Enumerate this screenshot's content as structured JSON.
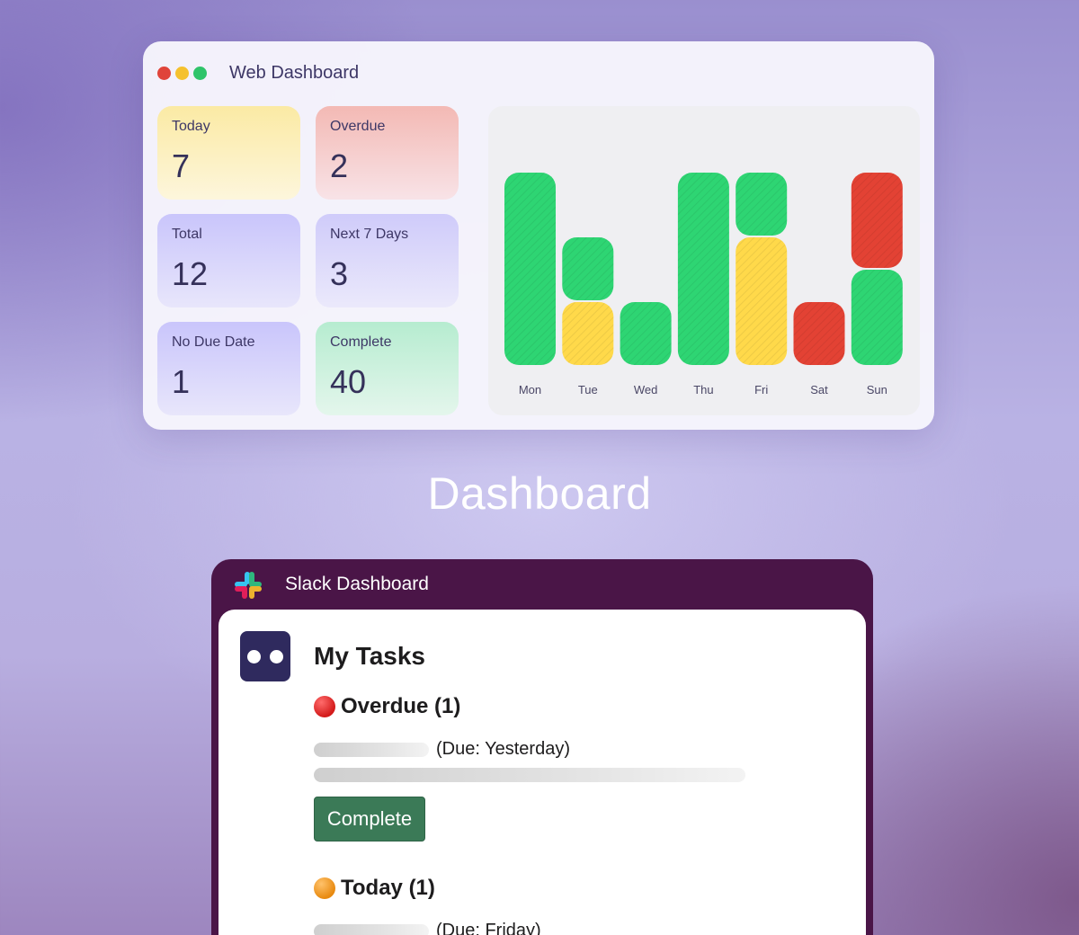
{
  "web_dashboard": {
    "title": "Web Dashboard",
    "window_dots": [
      "#e0443a",
      "#f5c12e",
      "#2fc46a"
    ],
    "stats": [
      {
        "label": "Today",
        "value": "7"
      },
      {
        "label": "Overdue",
        "value": "2"
      },
      {
        "label": "Total",
        "value": "12"
      },
      {
        "label": "Next 7 Days",
        "value": "3"
      },
      {
        "label": "No Due Date",
        "value": "1"
      },
      {
        "label": "Complete",
        "value": "40"
      }
    ]
  },
  "chart_data": {
    "type": "bar",
    "stacked": true,
    "categories": [
      "Mon",
      "Tue",
      "Wed",
      "Thu",
      "Fri",
      "Sat",
      "Sun"
    ],
    "series": [
      {
        "color": "#ffd94a",
        "values": [
          0,
          1,
          0,
          0,
          2,
          0,
          0
        ]
      },
      {
        "color": "#e34234",
        "values": [
          0,
          0,
          0,
          0,
          0,
          1,
          0
        ]
      },
      {
        "color": "#2ed573",
        "values": [
          3,
          1,
          1,
          3,
          1,
          0,
          1.5
        ]
      },
      {
        "color": "#e34234",
        "values": [
          0,
          0,
          0,
          0,
          0,
          0,
          1.5
        ]
      }
    ],
    "ylim": [
      0,
      4
    ],
    "title": "",
    "xlabel": "",
    "ylabel": "",
    "grid": false
  },
  "caption": "Dashboard",
  "slack": {
    "title": "Slack Dashboard",
    "section_title": "My Tasks",
    "overdue_heading": "Overdue (1)",
    "overdue_due": "(Due: Yesterday)",
    "complete_label": "Complete",
    "today_heading": "Today (1)",
    "today_due": "(Due: Friday)",
    "colors": {
      "header": "#4a1547",
      "button": "#3b7a57"
    }
  }
}
